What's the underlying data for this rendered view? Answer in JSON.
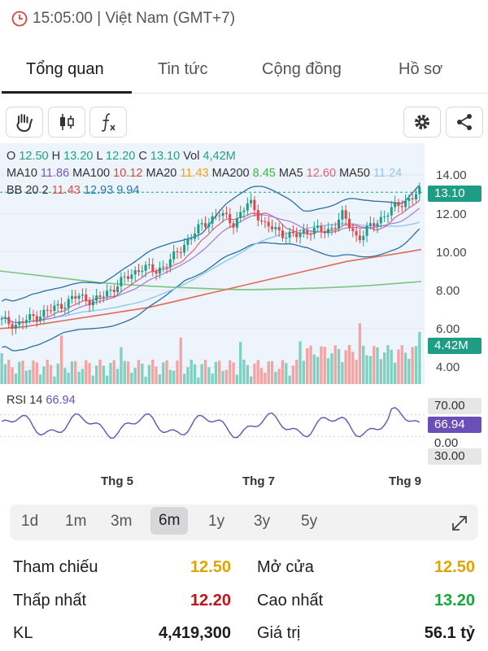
{
  "status": {
    "time_zone": "15:05:00 | Việt Nam (GMT+7)"
  },
  "tabs": [
    "Tổng quan",
    "Tin tức",
    "Cộng đồng",
    "Hồ sơ"
  ],
  "legend": {
    "ohlc": {
      "o_label": "O",
      "o": "12.50",
      "h_label": "H",
      "h": "13.20",
      "l_label": "L",
      "l": "12.20",
      "c_label": "C",
      "c": "13.10",
      "vol_label": "Vol",
      "vol": "4,42M"
    },
    "ma": [
      {
        "label": "MA10",
        "value": "11.86",
        "color": "#7a55c2"
      },
      {
        "label": "MA100",
        "value": "10.12",
        "color": "#d8483a"
      },
      {
        "label": "MA20",
        "value": "11.43",
        "color": "#f0a020"
      },
      {
        "label": "MA200",
        "value": "8.45",
        "color": "#44b34a"
      },
      {
        "label": "MA5",
        "value": "12.60",
        "color": "#e0607a"
      },
      {
        "label": "MA50",
        "value": "11.24",
        "color": "#8ec9ee"
      }
    ],
    "bb": {
      "label": "BB 20 2",
      "v1": "11.43",
      "v2": "12.93",
      "v3": "9.94"
    },
    "rsi": {
      "label": "RSI 14",
      "value": "66.94"
    }
  },
  "chart_data": {
    "type": "line",
    "title": "",
    "x": [
      "Thg 5",
      "Thg 7",
      "Thg 9"
    ],
    "price_axis": [
      "14.00",
      "12.00",
      "10.00",
      "8.00",
      "6.00",
      "4.00"
    ],
    "ylim": [
      3.5,
      14.5
    ],
    "last_price_label": "13.10",
    "last_volume_label": "4.42M",
    "series": [
      {
        "name": "Price",
        "values": [
          6.4,
          6.2,
          6.6,
          6.9,
          7.3,
          7.7,
          7.4,
          8.0,
          8.6,
          9.2,
          9.0,
          9.6,
          10.6,
          11.4,
          12.0,
          11.5,
          12.6,
          11.4,
          11.0,
          10.8,
          11.2,
          11.0,
          11.9,
          10.7,
          11.4,
          12.1,
          12.6,
          13.1
        ]
      },
      {
        "name": "MA200",
        "values": [
          9.0,
          8.85,
          8.7,
          8.55,
          8.4,
          8.3,
          8.22,
          8.15,
          8.1,
          8.05,
          8.03,
          8.05,
          8.08,
          8.12,
          8.18,
          8.25,
          8.35,
          8.45
        ]
      },
      {
        "name": "MA100",
        "values": [
          6.0,
          6.1,
          6.3,
          6.5,
          6.7,
          6.9,
          7.1,
          7.4,
          7.7,
          8.0,
          8.3,
          8.6,
          8.9,
          9.2,
          9.5,
          9.7,
          9.9,
          10.12
        ]
      }
    ],
    "rsi": {
      "label": "RSI 14",
      "value": 66.94,
      "levels": [
        "70.00",
        "0.00",
        "30.00"
      ]
    }
  },
  "ranges": {
    "items": [
      "1d",
      "1m",
      "3m",
      "6m",
      "1y",
      "3y",
      "5y"
    ],
    "selected": "6m"
  },
  "stats": [
    {
      "label": "Tham chiếu",
      "value": "12.50",
      "color": "#e0a400"
    },
    {
      "label": "Mở cửa",
      "value": "12.50",
      "color": "#e0a400"
    },
    {
      "label": "Thấp nhất",
      "value": "12.20",
      "color": "#c0141c"
    },
    {
      "label": "Cao nhất",
      "value": "13.20",
      "color": "#15a838"
    },
    {
      "label": "KL",
      "value": "4,419,300",
      "color": "#1d1d1d"
    },
    {
      "label": "Giá trị",
      "value": "56.1 tỷ",
      "color": "#1d1d1d"
    }
  ]
}
